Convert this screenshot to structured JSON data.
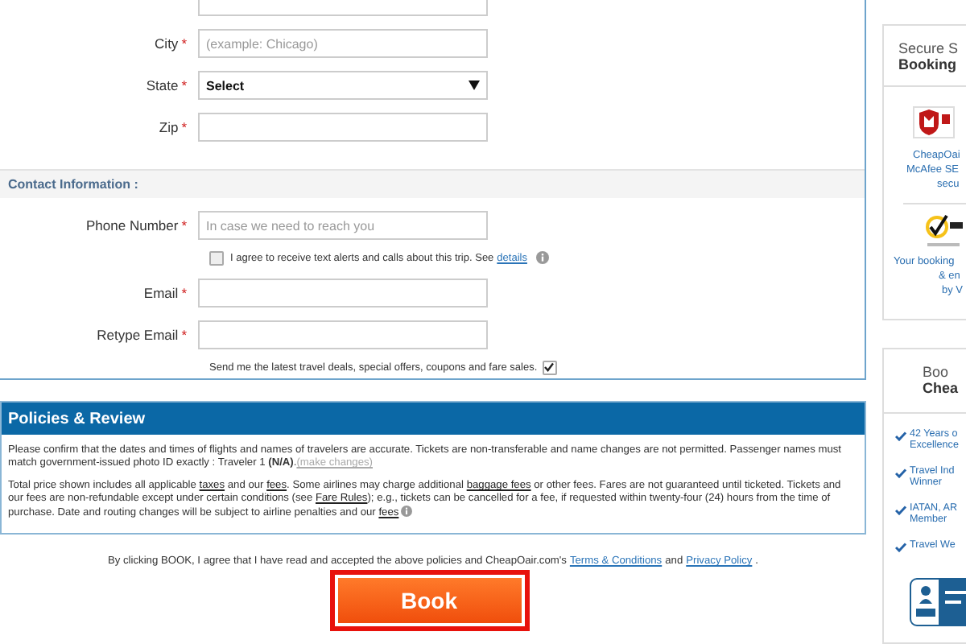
{
  "address": {
    "fields": [
      {
        "label": "City",
        "required_mark": "*",
        "kind": "input",
        "placeholder": "(example: Chicago)"
      },
      {
        "label": "State",
        "required_mark": "*",
        "kind": "select",
        "value": "Select"
      },
      {
        "label": "Zip",
        "required_mark": "*",
        "kind": "input"
      }
    ]
  },
  "contact": {
    "title": "Contact Information :",
    "phone": {
      "label": "Phone Number",
      "required_mark": "*",
      "placeholder": "In case we need to reach you"
    },
    "sms_consent": {
      "checked": false,
      "text": "I agree to receive text alerts and calls about this trip. See",
      "link": "details"
    },
    "email": {
      "label": "Email",
      "required_mark": "*"
    },
    "retype_email": {
      "label": "Retype Email",
      "required_mark": "*"
    },
    "newsletter": {
      "text": "Send me the latest travel deals, special offers, coupons and fare sales.",
      "checked": true
    }
  },
  "policies": {
    "title": "Policies & Review",
    "paragraphs": [
      [
        {
          "kind": "text",
          "text": "Please confirm that the dates and times of flights and names of travelers are accurate. Tickets are non-transferable and name changes are not permitted. Passenger names must match government-issued photo ID exactly : Traveler 1 "
        },
        {
          "kind": "bold",
          "text": "(N/A)"
        },
        {
          "kind": "text",
          "text": "."
        },
        {
          "kind": "muted-link",
          "text": "(make changes)"
        }
      ],
      [
        {
          "kind": "text",
          "text": "Total price shown includes all applicable "
        },
        {
          "kind": "link",
          "text": "taxes"
        },
        {
          "kind": "text",
          "text": " and our "
        },
        {
          "kind": "link",
          "text": "fees"
        },
        {
          "kind": "text",
          "text": ". Some airlines may charge additional "
        },
        {
          "kind": "link",
          "text": "baggage fees"
        },
        {
          "kind": "text",
          "text": " or other fees. Fares are not guaranteed until ticketed. Tickets and our fees are non-refundable except under certain conditions (see "
        },
        {
          "kind": "link",
          "text": "Fare Rules"
        },
        {
          "kind": "text",
          "text": "); e.g., tickets can be cancelled for a fee, if requested within twenty-four (24) hours from the time of purchase. Date and routing changes will be subject to airline penalties and our "
        },
        {
          "kind": "link",
          "text": "fees"
        },
        {
          "kind": "info"
        }
      ]
    ]
  },
  "agreement": {
    "text": "By clicking BOOK, I agree that I have read and accepted the above policies and CheapOair.com's",
    "link1": "Terms & Conditions",
    "middle": "and",
    "link2": "Privacy Policy",
    "end": "."
  },
  "book_button": "Book",
  "sidebar": {
    "secure_card": {
      "title": "Secure S",
      "subtitle": "Booking",
      "mcafee_lines": [
        "CheapOai",
        "McAfee SE",
        "secu"
      ],
      "norton_lines": [
        "Your booking",
        "& en",
        "by V"
      ]
    },
    "about_card": {
      "title": "Boo",
      "subtitle": "Chea",
      "items": [
        [
          "42 Years o",
          "Excellence"
        ],
        [
          "Travel Ind",
          "Winner"
        ],
        [
          "IATAN, AR",
          "Member"
        ],
        [
          "Travel We"
        ]
      ]
    }
  }
}
